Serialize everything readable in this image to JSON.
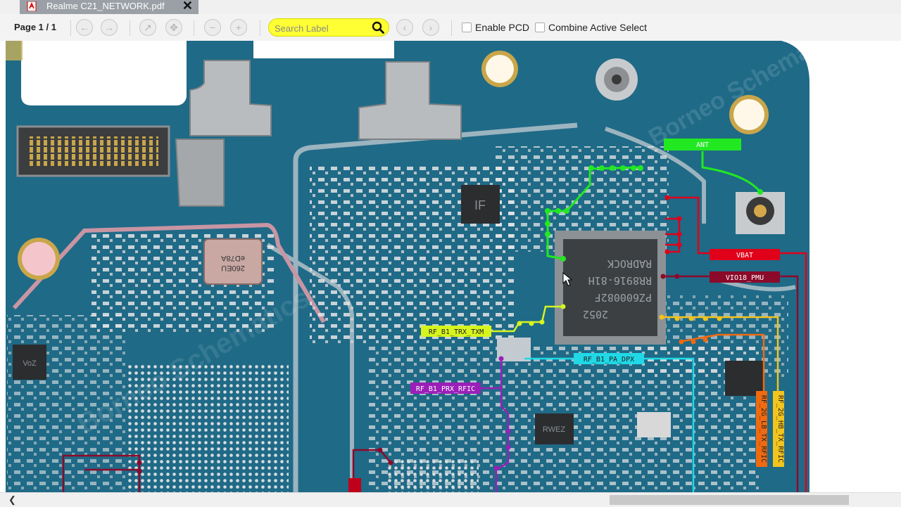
{
  "tab": {
    "title": "Realme C21_NETWORK.pdf",
    "close": "✕",
    "icon": "pdf-icon"
  },
  "toolbar": {
    "page_info": "Page 1 / 1",
    "search_placeholder": "Search Label",
    "enable_pcd_label": "Enable PCD",
    "combine_active_label": "Combine Active Select"
  },
  "nets": {
    "ant": "ANT",
    "vbat": "VBAT",
    "vio18": "VIO18_PMU",
    "rf_trx": "RF_B1_TRX_TXM",
    "rf_pa": "RF_B1_PA_DPX",
    "rf_prx": "RF_B1_PRX_RFIC",
    "rf_2g_lb": "RF_2G_LB_TX_RFIC",
    "rf_2g_hb": "RF_2G_HB_TX_RFIC"
  },
  "chip_markings": {
    "pa_line1": "2052",
    "pa_line2": "PZ600082F",
    "pa_line3": "RR8916-81H",
    "pa_line4": "RADROCK",
    "inductor_line1": "260EU",
    "inductor_line2": "eD78A",
    "ic_if": "IF",
    "ic_voz": "VoZ",
    "ic_rwez": "RWEZ"
  },
  "watermark": "Borneo Schematics",
  "colors": {
    "board": "#1f6a87",
    "ant": "#22e822",
    "vbat": "#e0001a",
    "vio18": "#8b0a2a",
    "rf_trx": "#d6f51e",
    "rf_pa": "#20d8e6",
    "rf_prx": "#9b1fb8",
    "rf_2g_lb": "#f06a10",
    "rf_2g_hb": "#f2c41e"
  }
}
